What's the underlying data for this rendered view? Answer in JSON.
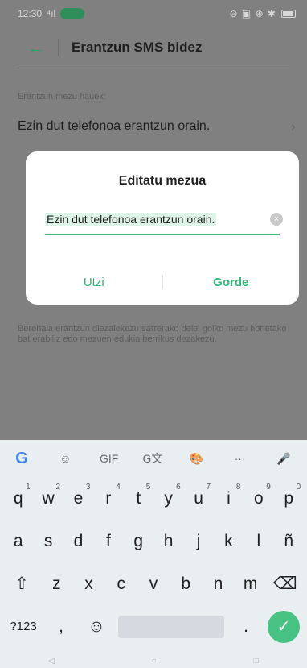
{
  "status_bar": {
    "time": "12:30",
    "signal": "⁴ıl",
    "icons": "⊝ ▣ ⊕ ✱"
  },
  "app_bar": {
    "back_icon": "←",
    "title": "Erantzun SMS bidez"
  },
  "content": {
    "section_label": "Erantzun mezu hauek:",
    "message_row": "Ezin dut telefonoa erantzun orain.",
    "row_chevron": "›",
    "footer_note": "Berehala erantzun diezaiekezu sarrerako deiei goiko mezu horietako bat erabiliz edo mezuen edukia berrikus dezakezu."
  },
  "dialog": {
    "title": "Editatu mezua",
    "input_value": "Ezin dut telefonoa erantzun orain.",
    "clear_icon": "×",
    "cancel_label": "Utzi",
    "save_label": "Gorde",
    "accent_color": "#35b673"
  },
  "keyboard": {
    "toolbar": {
      "google": "G",
      "sticker": "☺",
      "gif": "GIF",
      "translate": "G文",
      "palette": "🎨",
      "more": "···",
      "mic": "🎤"
    },
    "row1": [
      {
        "k": "q",
        "n": "1"
      },
      {
        "k": "w",
        "n": "2"
      },
      {
        "k": "e",
        "n": "3"
      },
      {
        "k": "r",
        "n": "4"
      },
      {
        "k": "t",
        "n": "5"
      },
      {
        "k": "y",
        "n": "6"
      },
      {
        "k": "u",
        "n": "7"
      },
      {
        "k": "i",
        "n": "8"
      },
      {
        "k": "o",
        "n": "9"
      },
      {
        "k": "p",
        "n": "0"
      }
    ],
    "row2": [
      "a",
      "s",
      "d",
      "f",
      "g",
      "h",
      "j",
      "k",
      "l",
      "ñ"
    ],
    "row3": [
      "z",
      "x",
      "c",
      "v",
      "b",
      "n",
      "m"
    ],
    "shift": "⇧",
    "backspace": "⌫",
    "symbols": "?123",
    "comma": ",",
    "emoji": "☺",
    "period": ".",
    "enter": "✓"
  }
}
